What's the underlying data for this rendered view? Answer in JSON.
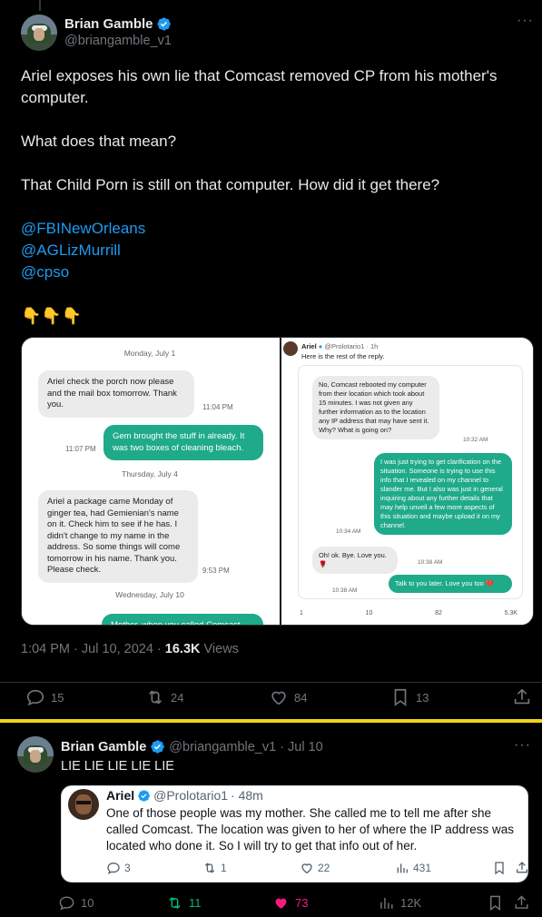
{
  "main_tweet": {
    "author_name": "Brian Gamble",
    "author_handle": "@briangamble_v1",
    "text_lines": [
      "Ariel exposes his own lie that Comcast removed CP from his mother's computer.",
      "What does that mean?",
      "That Child Porn is still on that computer. How did it get there?"
    ],
    "mentions": [
      "@FBINewOrleans",
      "@AGLizMurrill",
      "@cpso"
    ],
    "emojis": "👇👇👇",
    "timestamp": "1:04 PM · Jul 10, 2024 · ",
    "views_count": "16.3K",
    "views_label": " Views",
    "replies": "15",
    "retweets": "24",
    "likes": "84",
    "bookmarks": "13"
  },
  "media_left": {
    "date1": "Monday, July 1",
    "msg1": "Ariel check the porch now please and the mail box tomorrow. Thank you.",
    "msg1_time": "11:04 PM",
    "msg2": "Gem brought the stuff in already. It was two boxes of cleaning bleach.",
    "msg2_time": "11:07 PM",
    "date2": "Thursday, July 4",
    "msg3": "Ariel a package came Monday of ginger tea, had Gemienian's name on it. Check him to see if he has. I didn't change to my name in the address. So some things will come tomorrow in his name. Thank you. Please check.",
    "msg3_time": "9:53 PM",
    "date3": "Wednesday, July 10",
    "msg4": "Mother, when you called Comcast"
  },
  "media_right": {
    "author": "Ariel",
    "handle": "@Prolotario1 · 1h",
    "intro": "Here is the rest of the reply.",
    "msg1": "No, Comcast rebooted my computer from their location which took about 15 minutes. I was not given any further information as to the location any IP address that may have sent it. Why? What is going on?",
    "msg1_time": "10:32 AM",
    "msg2": "I was just trying to get clarification on the situation. Someone is trying to use this info that I revealed on my channel to slander me. But I also was just in general inquiring about any further details that may help unveil a few more aspects of this situation and maybe upload it on my channel.",
    "msg2_time": "10:34 AM",
    "msg3": "Oh! ok. Bye. Love you. 🌹",
    "msg3_time": "10:38 AM",
    "msg4": "Talk to you later. Love you too ❤️",
    "msg4_time": "10:38 AM",
    "stats": [
      "1",
      "10",
      "82",
      "5.3K"
    ]
  },
  "reply_tweet": {
    "author_name": "Brian Gamble",
    "author_handle": "@briangamble_v1",
    "date": "· Jul 10",
    "text": "LIE LIE LIE LIE LIE",
    "replies": "10",
    "retweets": "11",
    "likes": "73",
    "views": "12K"
  },
  "quoted": {
    "author_name": "Ariel",
    "author_handle": "@Prolotario1",
    "time": "· 48m",
    "text": "One of those people was my mother. She called me to tell me after she called Comcast. The location was given to her of where the IP address was located who done it. So I will try to get that info out of her.",
    "replies": "3",
    "retweets": "1",
    "likes": "22",
    "views": "431"
  },
  "colors": {
    "accent": "#1d9bf0",
    "like": "#f91880",
    "retweet": "#00ba7c",
    "divider": "#f2d31f"
  }
}
